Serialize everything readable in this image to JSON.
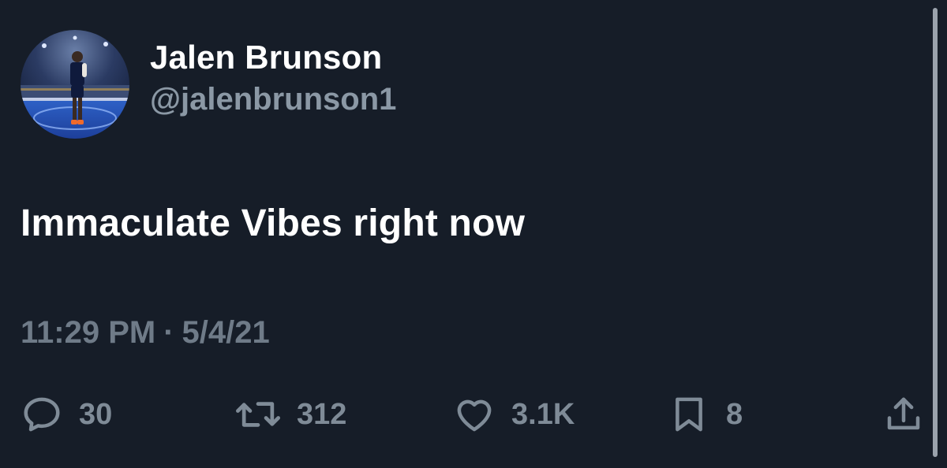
{
  "author": {
    "display_name": "Jalen Brunson",
    "handle": "@jalenbrunson1",
    "avatar": "player-on-court-photo"
  },
  "tweet": {
    "text": "Immaculate Vibes right now",
    "time": "11:29 PM",
    "separator": "·",
    "date": "5/4/21"
  },
  "actions": {
    "reply": {
      "icon": "reply-icon",
      "count": "30"
    },
    "retweet": {
      "icon": "retweet-icon",
      "count": "312"
    },
    "like": {
      "icon": "heart-icon",
      "count": "3.1K"
    },
    "bookmark": {
      "icon": "bookmark-icon",
      "count": "8"
    },
    "share": {
      "icon": "share-icon"
    }
  },
  "colors": {
    "background": "#161d28",
    "primary_text": "#ffffff",
    "secondary_text": "#8b98a5",
    "icon": "#7f8b97"
  }
}
